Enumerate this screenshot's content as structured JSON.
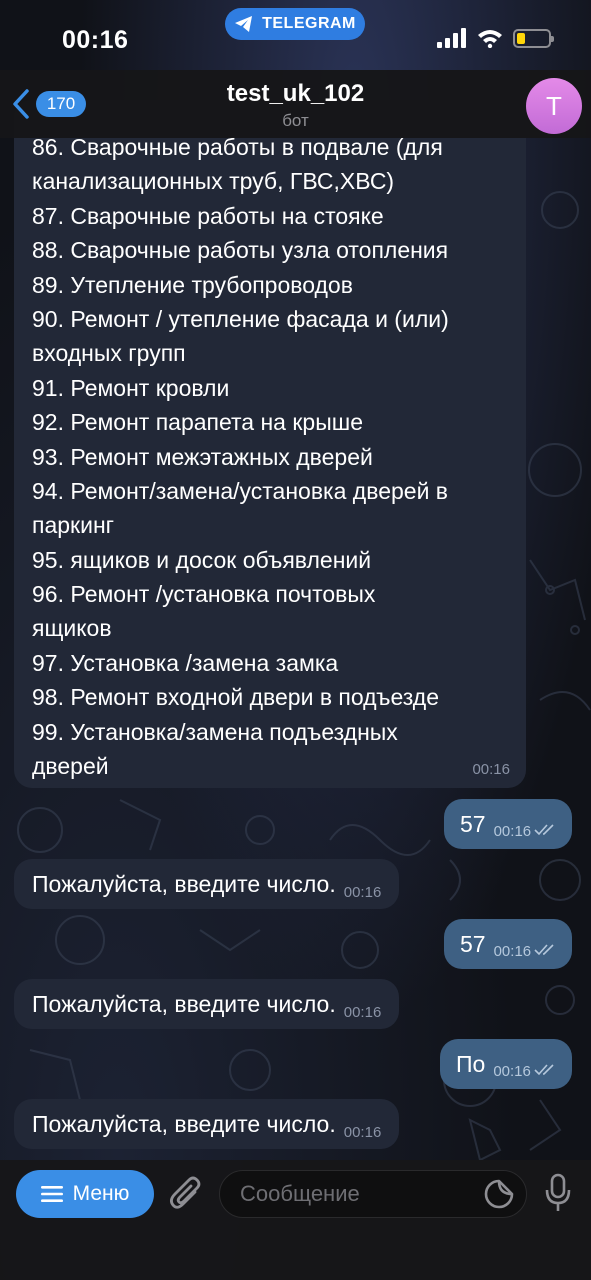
{
  "status_bar": {
    "time": "00:16",
    "telegram_pill": "TELEGRAM",
    "battery_level": 0.25,
    "battery_color": "#ffd60a"
  },
  "header": {
    "back_count": "170",
    "title": "test_uk_102",
    "subtitle": "бот",
    "avatar_letter": "T",
    "avatar_color": "#d37bdf"
  },
  "messages": {
    "list_message": {
      "lines": [
        "86. Сварочные работы в подвале (для",
        "канализационных труб, ГВС,ХВС)",
        "87. Сварочные работы на стояке",
        "88. Сварочные работы узла отопления",
        "89. Утепление трубопроводов",
        "90. Ремонт / утепление фасада и (или)",
        "входных групп",
        "91. Ремонт кровли",
        "92. Ремонт парапета на крыше",
        "93. Ремонт межэтажных дверей",
        "94. Ремонт/замена/установка дверей в",
        "паркинг",
        "95. ящиков и досок объявлений",
        "96. Ремонт /установка почтовых",
        "ящиков",
        "97. Установка /замена замка",
        "98. Ремонт входной двери в подъезде",
        "99. Установка/замена подъездных",
        "дверей"
      ],
      "time": "00:16"
    },
    "outgoing": [
      {
        "text": "57",
        "time": "00:16"
      },
      {
        "text": "57",
        "time": "00:16"
      },
      {
        "text": "По",
        "time": "00:16"
      }
    ],
    "incoming": [
      {
        "text": "Пожалуйста, введите число.",
        "time": "00:16"
      },
      {
        "text": "Пожалуйста, введите число.",
        "time": "00:16"
      },
      {
        "text": "Пожалуйста, введите число.",
        "time": "00:16"
      }
    ]
  },
  "input_bar": {
    "menu_label": "Меню",
    "placeholder": "Сообщение",
    "icons": [
      "attach-icon",
      "sticker-icon",
      "microphone-icon"
    ]
  },
  "colors": {
    "accent": "#3a8ee6",
    "incoming_bubble": "#222837",
    "outgoing_bubble": "#3e6083"
  }
}
